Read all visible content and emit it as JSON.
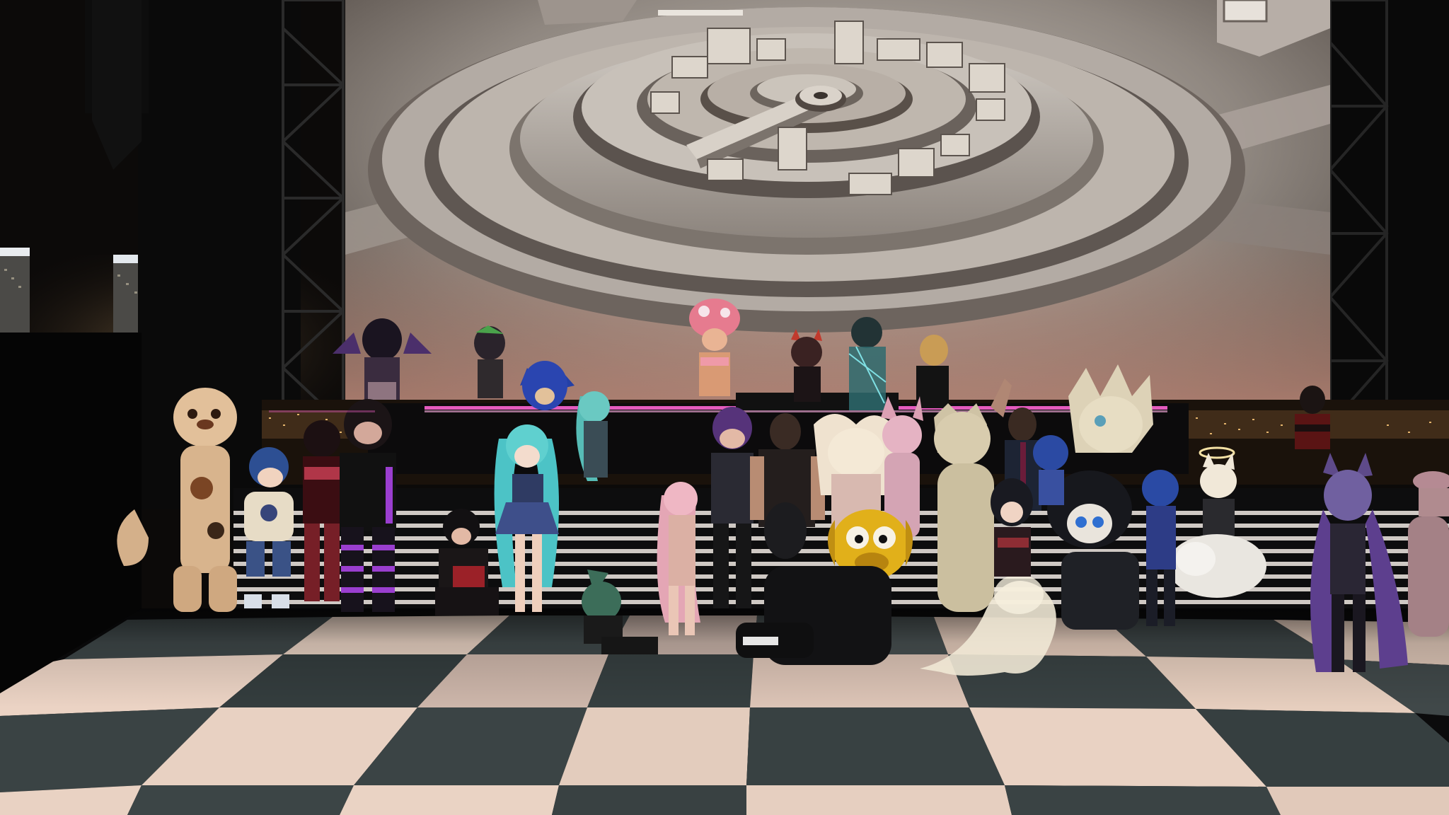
{
  "scene": {
    "kind": "virtual-reality-event-group-photo",
    "ui_text": [],
    "screen_content": "concentric-ring-city-platform",
    "palette": {
      "sky": "#0d0b0a",
      "city_glow": "#c7a06a",
      "screen_light": "#c8c2bb",
      "screen_dark": "#4a4440",
      "screen_warm": "#d89b86",
      "floor_light": "#ead3c4",
      "floor_dark": "#3d4647",
      "neon_pink": "#e35bbd",
      "truss": "#1b1b1b"
    },
    "avatars": [
      {
        "name": "calico-cat",
        "color": "#d8b48d"
      },
      {
        "name": "blue-hoodie-kid",
        "color": "#2d4f93"
      },
      {
        "name": "red-outfit-girl",
        "color": "#8a2630"
      },
      {
        "name": "black-purple-stripes",
        "color": "#2b2130"
      },
      {
        "name": "crouching-red-boy",
        "color": "#1e1a1c"
      },
      {
        "name": "teal-twintail-girl",
        "color": "#4cc3c6"
      },
      {
        "name": "green-hooded-sitter",
        "color": "#3c6d59"
      },
      {
        "name": "pink-long-hair",
        "color": "#e4a6b5"
      },
      {
        "name": "purple-hair-boy",
        "color": "#56337a"
      },
      {
        "name": "muscle-man",
        "color": "#3a332f"
      },
      {
        "name": "yellow-dog",
        "color": "#e1b01a"
      },
      {
        "name": "white-fluffy-creature",
        "color": "#d9d4bc"
      },
      {
        "name": "pink-fox",
        "color": "#dca0b4"
      },
      {
        "name": "tan-protogen",
        "color": "#cfc3a5"
      },
      {
        "name": "suit-man",
        "color": "#1d2434"
      },
      {
        "name": "black-hair-girl",
        "color": "#191a21"
      },
      {
        "name": "white-ghost-blob",
        "color": "#efe8d5"
      },
      {
        "name": "spiky-white-beast",
        "color": "#ddd2b7"
      },
      {
        "name": "blue-hair-girl",
        "color": "#2b4aa3"
      },
      {
        "name": "halo-fox",
        "color": "#f1e8d8"
      },
      {
        "name": "purple-cat-girl",
        "color": "#5e4a8a"
      },
      {
        "name": "pink-witch",
        "color": "#b58a93"
      },
      {
        "name": "red-black-jacket",
        "color": "#5a1414"
      },
      {
        "name": "toad-performer",
        "color": "#d85a72"
      },
      {
        "name": "sonic",
        "color": "#2440a6"
      },
      {
        "name": "miku",
        "color": "#57bcb6"
      },
      {
        "name": "dj-red-horns",
        "color": "#c13a2d"
      },
      {
        "name": "hologram-guy",
        "color": "#3a8b8f"
      },
      {
        "name": "blond-guy",
        "color": "#c99c55"
      },
      {
        "name": "bat-wing-girl",
        "color": "#6b4a7d"
      },
      {
        "name": "green-hair-dj",
        "color": "#4aa24b"
      }
    ]
  }
}
